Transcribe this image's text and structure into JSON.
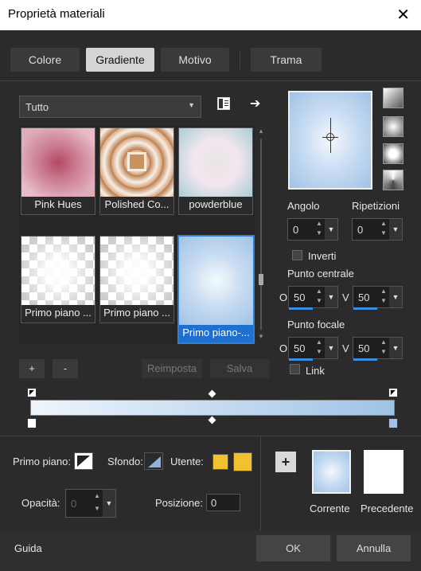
{
  "window": {
    "title": "Proprietà materiali",
    "close_glyph": "✕"
  },
  "tabs": [
    {
      "label": "Colore"
    },
    {
      "label": "Gradiente"
    },
    {
      "label": "Motivo"
    },
    {
      "label": "Trama"
    }
  ],
  "active_tab": "Gradiente",
  "category": {
    "selected": "Tutto"
  },
  "presets": [
    {
      "label": "Pink Hues"
    },
    {
      "label": "Polished Co..."
    },
    {
      "label": "powderblue"
    },
    {
      "label": "Primo piano ..."
    },
    {
      "label": "Primo piano ..."
    },
    {
      "label": "Primo piano-..."
    }
  ],
  "buttons": {
    "add": "+",
    "remove": "-",
    "reset": "Reimposta",
    "save": "Salva",
    "ok": "OK",
    "cancel": "Annulla",
    "help": "Guida"
  },
  "angle": {
    "label": "Angolo",
    "value": "0"
  },
  "repeats": {
    "label": "Ripetizioni",
    "value": "0"
  },
  "invert": {
    "label": "Inverti",
    "checked": false
  },
  "center_point": {
    "label": "Punto centrale",
    "o_label": "O",
    "o_value": "50",
    "v_label": "V",
    "v_value": "50"
  },
  "focal_point": {
    "label": "Punto focale",
    "o_label": "O",
    "o_value": "50",
    "v_label": "V",
    "v_value": "50"
  },
  "link": {
    "label": "Link",
    "checked": false
  },
  "bottom": {
    "foreground_label": "Primo piano:",
    "background_label": "Sfondo:",
    "user_label": "Utente:",
    "user_color": "#f2c12e",
    "opacity_label": "Opacità:",
    "opacity_value": "0",
    "position_label": "Posizione:",
    "position_value": "0"
  },
  "preview": {
    "current_label": "Corrente",
    "previous_label": "Precedente"
  },
  "gradient_colors": {
    "start": "#eef5fc",
    "end": "#9fc3e6",
    "selection": "#1e6fd0"
  }
}
